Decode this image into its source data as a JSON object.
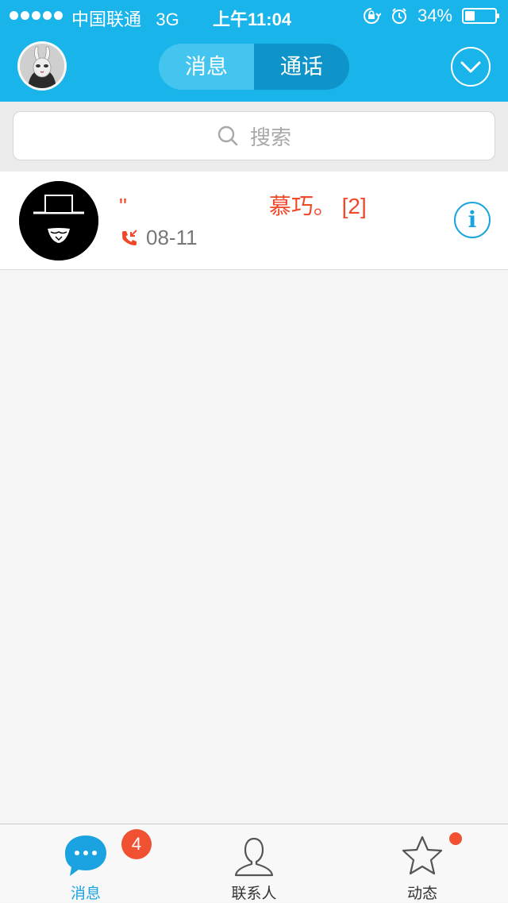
{
  "status_bar": {
    "carrier": "中国联通",
    "network": "3G",
    "time": "上午11:04",
    "battery_text": "34%",
    "battery_level": 0.34
  },
  "header": {
    "tabs": [
      {
        "label": "消息",
        "active": false
      },
      {
        "label": "通话",
        "active": true
      }
    ],
    "avatar_icon": "user-avatar-rabbit-mask",
    "dropdown_icon": "chevron-down-circle-icon"
  },
  "search": {
    "placeholder": "搜索",
    "icon": "search-icon"
  },
  "calls": [
    {
      "name": "\"                       慕巧。 [2]",
      "time": "08-11",
      "call_type_icon": "incoming-missed-call-icon",
      "info_icon": "info-icon"
    }
  ],
  "tabbar": {
    "items": [
      {
        "label": "消息",
        "icon": "chat-bubble-icon",
        "badge": "4",
        "active": true
      },
      {
        "label": "联系人",
        "icon": "contact-person-icon",
        "active": false
      },
      {
        "label": "动态",
        "icon": "star-icon",
        "has_dot": true,
        "active": false
      }
    ]
  },
  "colors": {
    "accent": "#19b4ea",
    "missed_call": "#f0492a",
    "badge": "#f15133"
  }
}
